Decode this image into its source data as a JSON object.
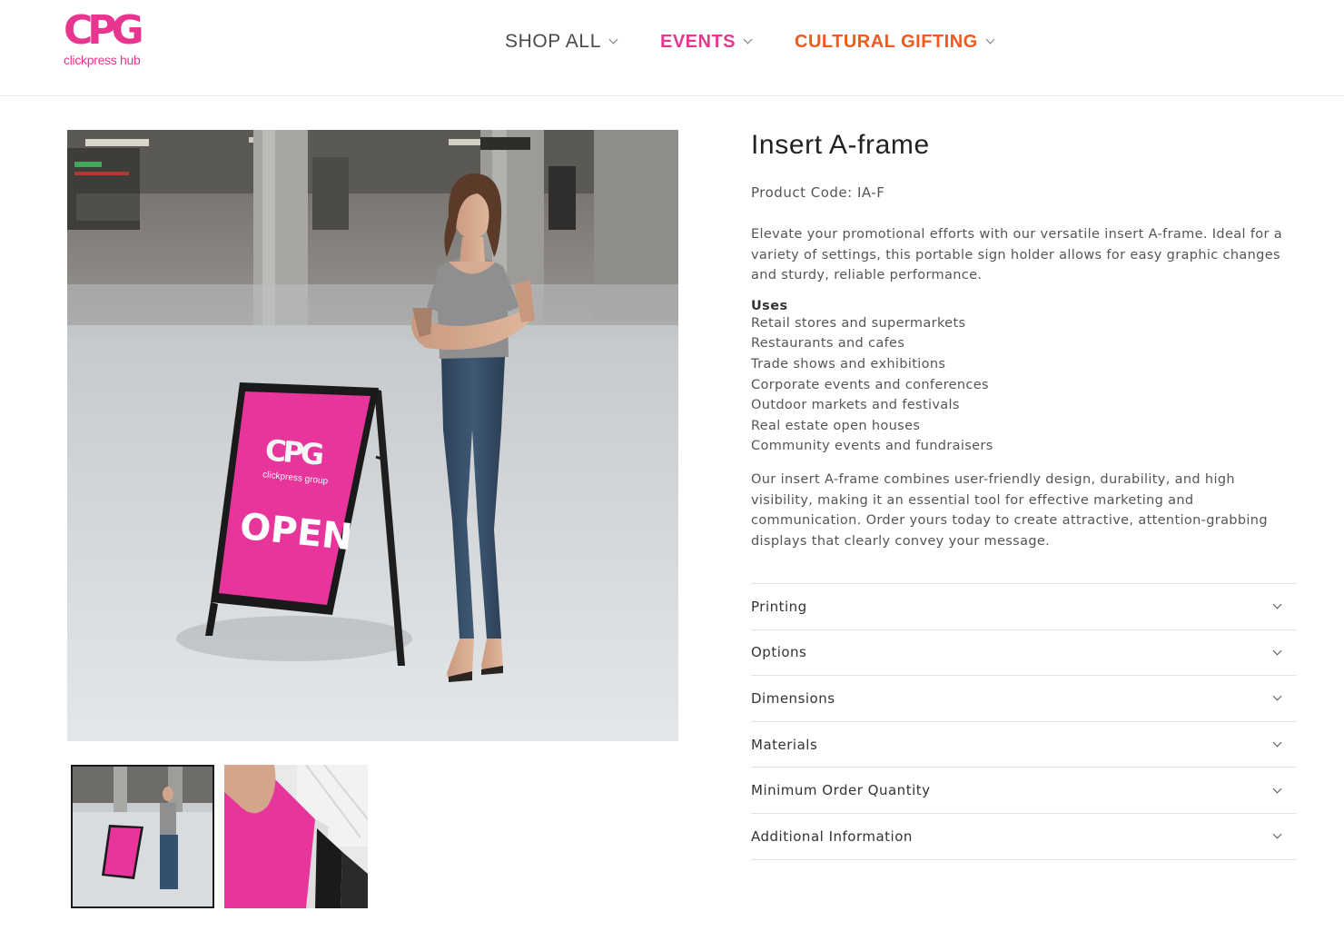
{
  "brand": {
    "logo_mark": "CPG",
    "logo_sub": "clickpress hub",
    "pink": "#e8358f",
    "orange": "#f05a1e"
  },
  "nav": {
    "items": [
      {
        "label": "SHOP ALL"
      },
      {
        "label": "EVENTS"
      },
      {
        "label": "CULTURAL GIFTING"
      }
    ]
  },
  "gallery": {
    "sign_logo": "CPG",
    "sign_sub": "clickpress group",
    "sign_text": "OPEN"
  },
  "product": {
    "title": "Insert A-frame",
    "code": "Product Code: IA-F",
    "description": "Elevate your promotional efforts with our versatile insert A-frame. Ideal for a variety of settings, this portable sign holder allows for easy graphic changes and sturdy, reliable performance.",
    "uses_title": "Uses",
    "uses": [
      "Retail stores and supermarkets",
      "Restaurants and cafes",
      "Trade shows and exhibitions",
      "Corporate events and conferences",
      "Outdoor markets and festivals",
      "Real estate open houses",
      "Community events and fundraisers"
    ],
    "outro": "Our insert A-frame combines user-friendly design, durability, and high visibility, making it an essential tool for effective marketing and communication. Order yours today to create attractive, attention-grabbing displays that clearly convey your message."
  },
  "accordion": [
    {
      "label": "Printing"
    },
    {
      "label": "Options"
    },
    {
      "label": "Dimensions"
    },
    {
      "label": "Materials"
    },
    {
      "label": "Minimum Order Quantity"
    },
    {
      "label": "Additional Information"
    }
  ]
}
